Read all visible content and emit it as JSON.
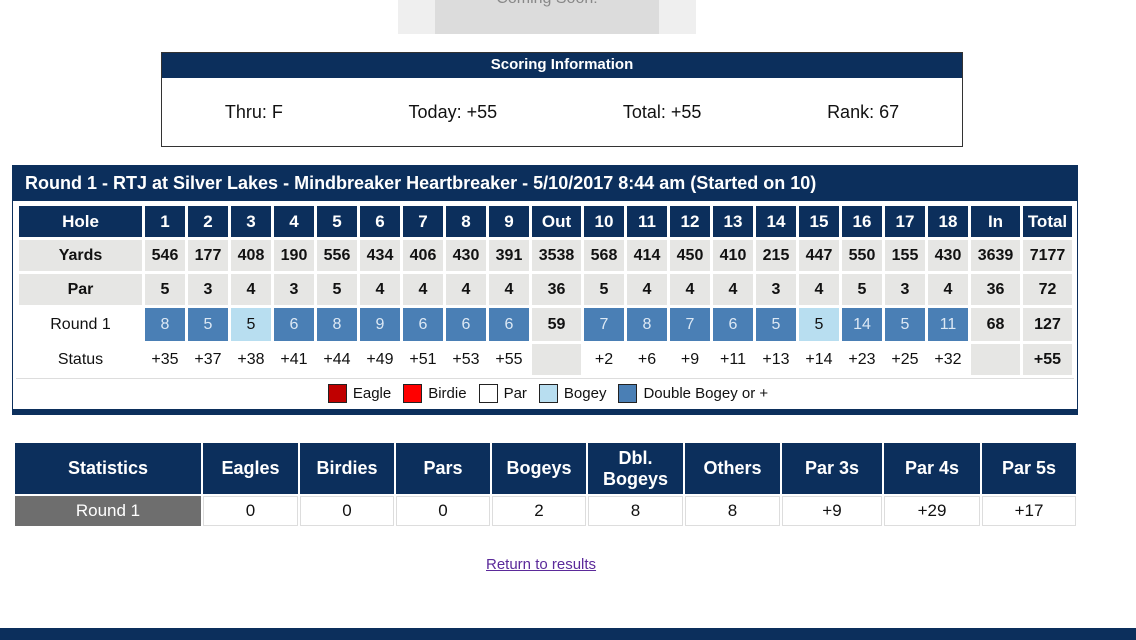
{
  "coming_soon": "Coming Soon!",
  "scoring": {
    "title": "Scoring Information",
    "thru": "Thru: F",
    "today": "Today: +55",
    "total": "Total: +55",
    "rank": "Rank: 67"
  },
  "card": {
    "title": "Round 1 - RTJ at Silver Lakes - Mindbreaker Heartbreaker - 5/10/2017 8:44 am (Started on 10)",
    "labels": {
      "hole": "Hole",
      "yards": "Yards",
      "par": "Par",
      "round": "Round 1",
      "status": "Status",
      "out": "Out",
      "in": "In",
      "total": "Total"
    },
    "holes": [
      "1",
      "2",
      "3",
      "4",
      "5",
      "6",
      "7",
      "8",
      "9",
      "10",
      "11",
      "12",
      "13",
      "14",
      "15",
      "16",
      "17",
      "18"
    ],
    "yards": [
      "546",
      "177",
      "408",
      "190",
      "556",
      "434",
      "406",
      "430",
      "391",
      "568",
      "414",
      "450",
      "410",
      "215",
      "447",
      "550",
      "155",
      "430"
    ],
    "yards_out": "3538",
    "yards_in": "3639",
    "yards_total": "7177",
    "par": [
      "5",
      "3",
      "4",
      "3",
      "5",
      "4",
      "4",
      "4",
      "4",
      "5",
      "4",
      "4",
      "4",
      "3",
      "4",
      "5",
      "3",
      "4"
    ],
    "par_out": "36",
    "par_in": "36",
    "par_total": "72",
    "scores": [
      "8",
      "5",
      "5",
      "6",
      "8",
      "9",
      "6",
      "6",
      "6",
      "7",
      "8",
      "7",
      "6",
      "5",
      "5",
      "14",
      "5",
      "11"
    ],
    "score_types": [
      "dbl",
      "dbl",
      "bog",
      "dbl",
      "dbl",
      "dbl",
      "dbl",
      "dbl",
      "dbl",
      "dbl",
      "dbl",
      "dbl",
      "dbl",
      "dbl",
      "bog",
      "dbl",
      "dbl",
      "dbl"
    ],
    "score_out": "59",
    "score_in": "68",
    "score_total": "127",
    "status": [
      "+35",
      "+37",
      "+38",
      "+41",
      "+44",
      "+49",
      "+51",
      "+53",
      "+55",
      "+2",
      "+6",
      "+9",
      "+11",
      "+13",
      "+14",
      "+23",
      "+25",
      "+32"
    ],
    "status_total": "+55",
    "legend": [
      {
        "label": "Eagle",
        "color": "#c00000"
      },
      {
        "label": "Birdie",
        "color": "#ff0000"
      },
      {
        "label": "Par",
        "color": "#ffffff"
      },
      {
        "label": "Bogey",
        "color": "#b8def0"
      },
      {
        "label": "Double Bogey or +",
        "color": "#4a7fb5"
      }
    ]
  },
  "stats": {
    "headers": [
      "Statistics",
      "Eagles",
      "Birdies",
      "Pars",
      "Bogeys",
      "Dbl. Bogeys",
      "Others",
      "Par 3s",
      "Par 4s",
      "Par 5s"
    ],
    "row": [
      "Round 1",
      "0",
      "0",
      "0",
      "2",
      "8",
      "8",
      "+9",
      "+29",
      "+17"
    ]
  },
  "return_link": "Return to results"
}
